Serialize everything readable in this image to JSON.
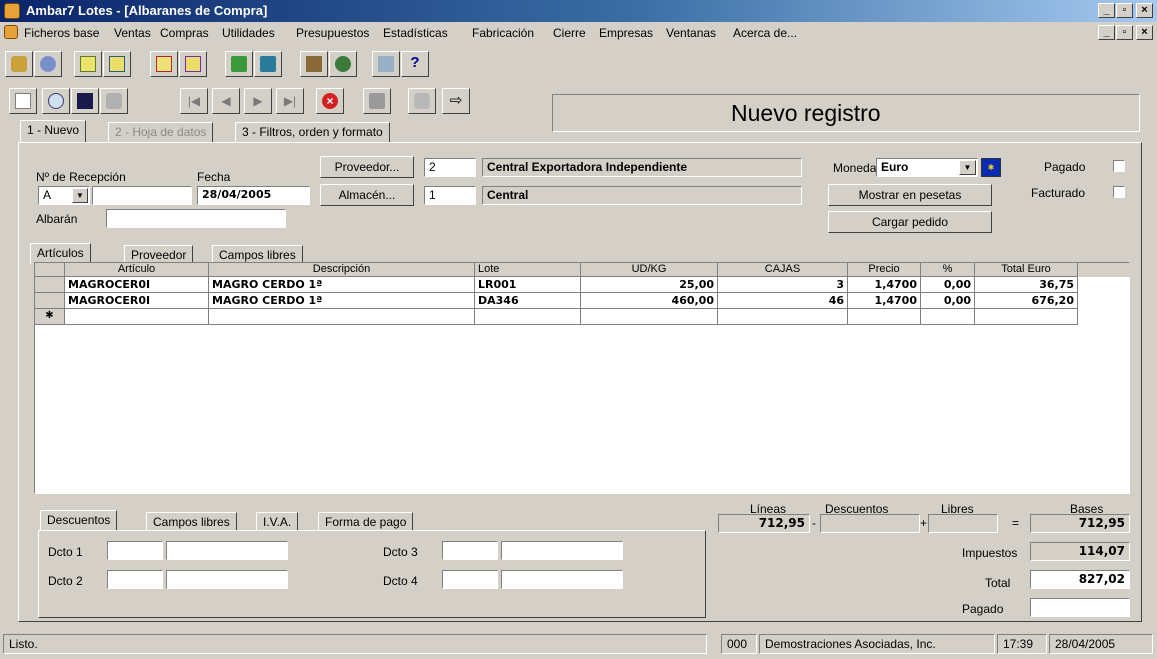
{
  "window": {
    "title": "Ambar7 Lotes - [Albaranes de Compra]"
  },
  "menu": [
    "Ficheros base",
    "Ventas",
    "Compras",
    "Utilidades",
    "Presupuestos",
    "Estadísticas",
    "Fabricación",
    "Cierre",
    "Empresas",
    "Ventanas",
    "Acerca de..."
  ],
  "header": {
    "status_banner": "Nuevo registro"
  },
  "main_tabs": [
    "1 - Nuevo",
    "2 - Hoja de datos",
    "3 - Filtros, orden y formato"
  ],
  "form": {
    "recepcion_label": "Nº de Recepción",
    "serie": "A",
    "numero": "",
    "fecha_label": "Fecha",
    "fecha": "28/04/2005",
    "proveedor_button": "Proveedor...",
    "proveedor_code": "2",
    "proveedor_name": "Central Exportadora Independiente",
    "almacen_button": "Almacén...",
    "almacen_code": "1",
    "almacen_name": "Central",
    "albaran_label": "Albarán",
    "albaran": "",
    "moneda_label": "Moneda",
    "moneda": "Euro",
    "pagado_label": "Pagado",
    "facturado_label": "Facturado",
    "mostrar_pesetas": "Mostrar en pesetas",
    "cargar_pedido": "Cargar pedido"
  },
  "detail_tabs": [
    "Artículos",
    "Proveedor",
    "Campos libres"
  ],
  "grid": {
    "columns": [
      "Artículo",
      "Descripción",
      "Lote",
      "UD/KG",
      "CAJAS",
      "Precio",
      "%",
      "Total Euro"
    ],
    "rows": [
      [
        "MAGROCER0I",
        "MAGRO CERDO 1ª",
        "LR001",
        "25,00",
        "3",
        "1,4700",
        "0,00",
        "36,75"
      ],
      [
        "MAGROCER0I",
        "MAGRO CERDO 1ª",
        "DA346",
        "460,00",
        "46",
        "1,4700",
        "0,00",
        "676,20"
      ]
    ],
    "new_row_marker": "✱"
  },
  "bottom_tabs": [
    "Descuentos",
    "Campos libres",
    "I.V.A.",
    "Forma de pago"
  ],
  "descuentos": [
    "Dcto 1",
    "Dcto 2",
    "Dcto 3",
    "Dcto 4"
  ],
  "totals": {
    "lineas_label": "Líneas",
    "lineas": "712,95",
    "descuentos_label": "Descuentos",
    "libres_label": "Libres",
    "bases_label": "Bases",
    "bases": "712,95",
    "impuestos_label": "Impuestos",
    "impuestos": "114,07",
    "total_label": "Total",
    "total": "827,02",
    "pagado_label": "Pagado",
    "pagado": "",
    "minus": "-",
    "plus": "+",
    "equals": "="
  },
  "statusbar": {
    "message": "Listo.",
    "code": "000",
    "company": "Demostraciones Asociadas, Inc.",
    "time": "17:39",
    "date": "28/04/2005"
  }
}
